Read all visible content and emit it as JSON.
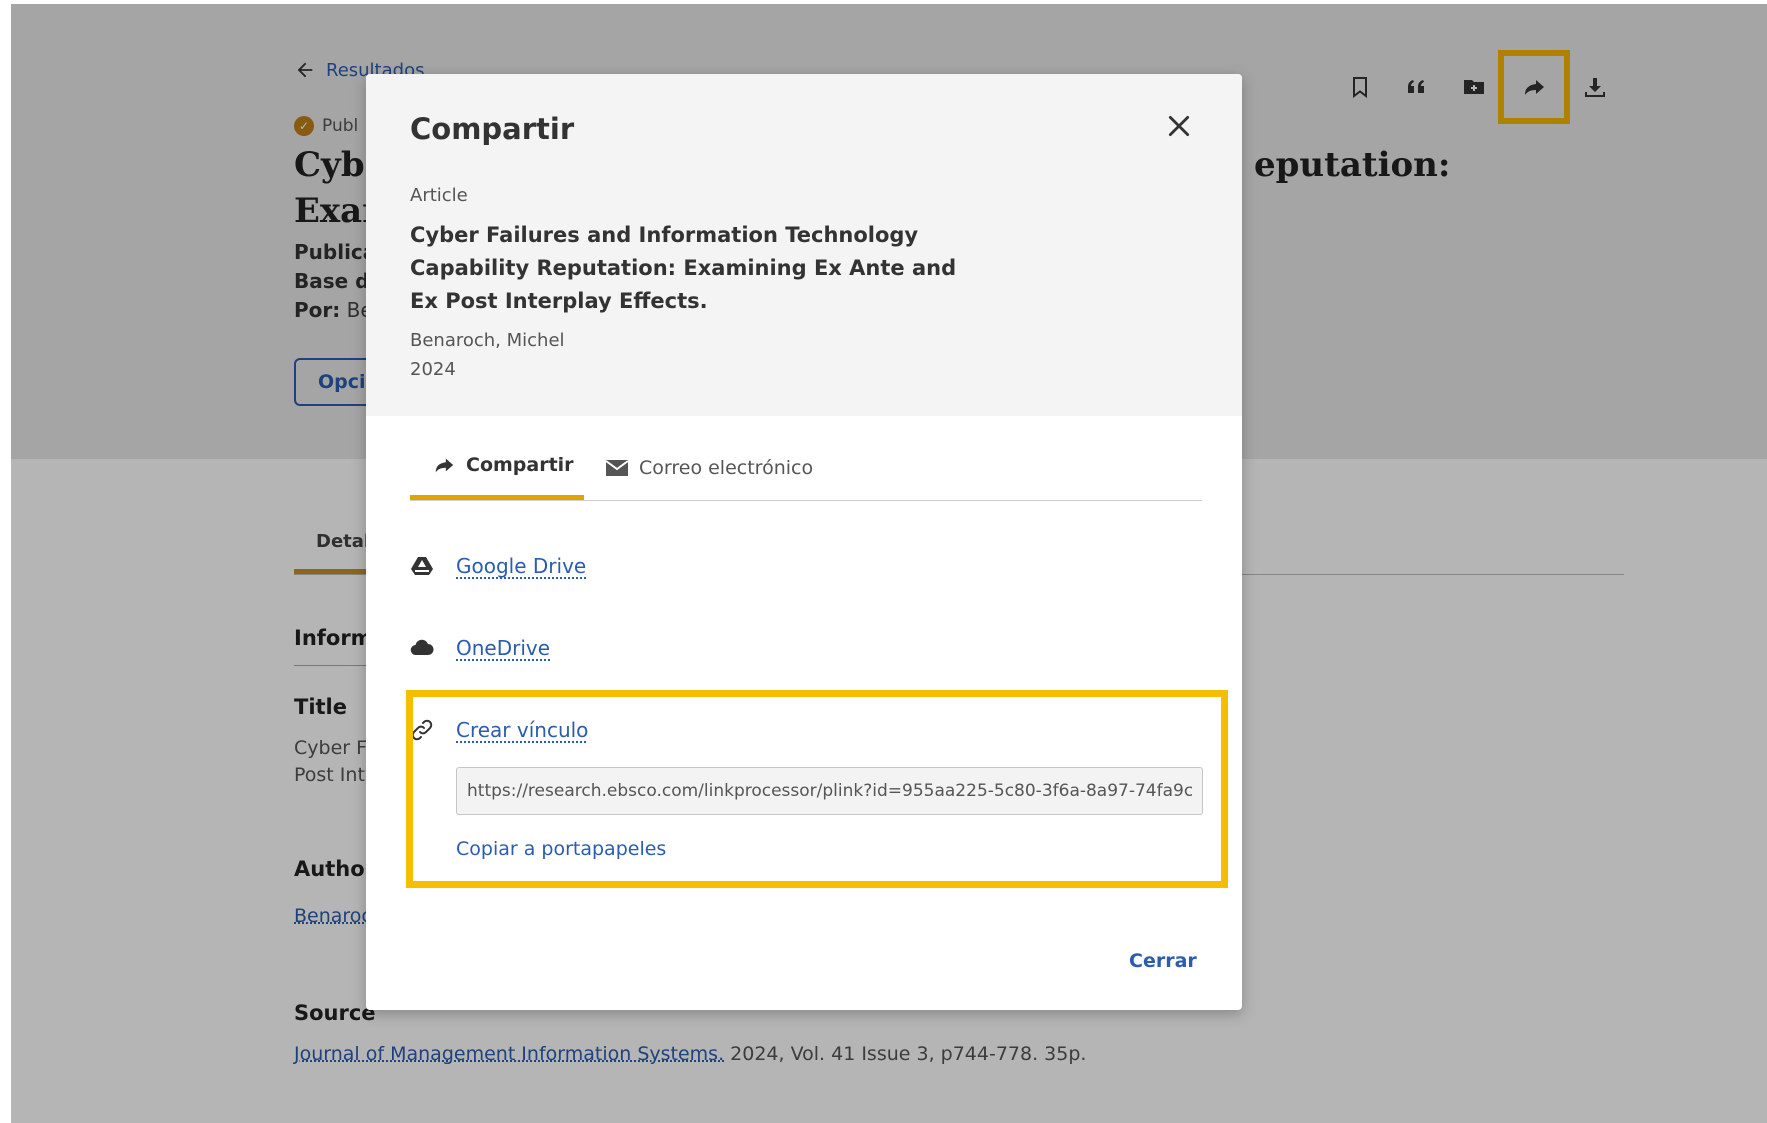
{
  "page": {
    "back_label": "Resultados",
    "pub_type_label": "Publ",
    "title_left_line1": "Cybe",
    "title_left_line2": "Exar",
    "title_right": "eputation:",
    "meta_pub": "Publica",
    "meta_db": "Base d",
    "meta_by_label": "Por:",
    "meta_by_value": "Be",
    "options_button": "Opci",
    "tab_details": "Detal",
    "info_heading": "Inform",
    "title_heading": "Title",
    "title_line1": "Cyber Fa",
    "title_line2": "Post Int",
    "author_heading": "Author",
    "author_value": "Benaroc",
    "source_heading": "Source",
    "source_journal": "Journal of Management Information Systems.",
    "source_rest": " 2024, Vol. 41 Issue 3, p744-778. 35p."
  },
  "toolbar": {
    "icons": [
      "bookmark-icon",
      "cite-quote-icon",
      "add-folder-icon",
      "share-icon",
      "download-icon"
    ],
    "active": "share-icon",
    "highlight_color": "#f5b800"
  },
  "modal": {
    "title": "Compartir",
    "article_type": "Article",
    "article_title": "Cyber Failures and Information Technology Capability Reputation: Examining Ex Ante and Ex Post Interplay Effects.",
    "author": "Benaroch, Michel",
    "year": "2024",
    "tabs": [
      {
        "label": "Compartir",
        "icon": "share-icon",
        "active": true
      },
      {
        "label": "Correo electrónico",
        "icon": "envelope-icon",
        "active": false
      }
    ],
    "services": [
      {
        "label": "Google Drive",
        "icon": "google-drive-icon"
      },
      {
        "label": "OneDrive",
        "icon": "cloud-icon"
      },
      {
        "label": "Crear vínculo",
        "icon": "link-icon"
      }
    ],
    "link_value": "https://research.ebsco.com/linkprocessor/plink?id=955aa225-5c80-3f6a-8a97-74fa9c",
    "copy_label": "Copiar a portapapeles",
    "close_label": "Cerrar"
  },
  "colors": {
    "accent_blue": "#2a5db0",
    "highlight_yellow": "#f5be00",
    "tab_underline": "#e0a400"
  }
}
